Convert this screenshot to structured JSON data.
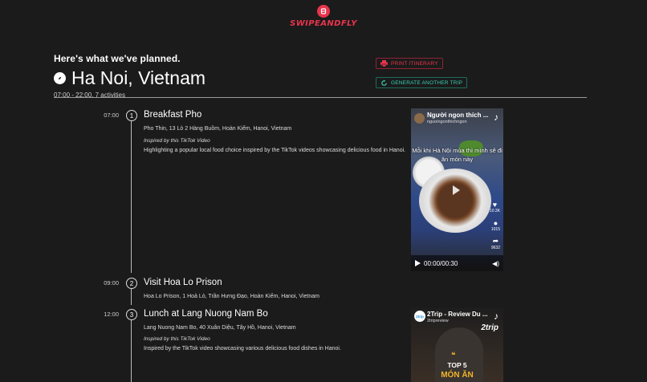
{
  "brand": {
    "name": "SWIPEANDFLY",
    "color": "#e8344c"
  },
  "header": {
    "planned_label": "Here's what we've planned.",
    "city": "Ha Noi, Vietnam",
    "meta": "07:00 - 22:00, 7 activities",
    "compass_icon": "compass-icon"
  },
  "buttons": {
    "print": {
      "label": "PRINT ITINERARY",
      "icon": "printer-icon",
      "color": "#e8344c"
    },
    "generate": {
      "label": "GENERATE ANOTHER TRIP",
      "icon": "refresh-icon",
      "color": "#38d0b0"
    }
  },
  "activities": [
    {
      "time": "07:00",
      "number": "1",
      "title": "Breakfast Pho",
      "address": "Pho Thin, 13 Lò 2 Hàng Buồm, Hoàn Kiếm, Hanoi, Vietnam",
      "inspired": "Inspired by this TikTok Video",
      "description": "Highlighting a popular local food choice inspired by the TikTok videos showcasing delicious food in Hanoi.",
      "video": {
        "title": "Người ngon thích ...",
        "user": "nguoingonthichngon",
        "caption": "Mỗi khi Hà Nội mùa thì mình sẽ đi ăn món này",
        "likes": "10.3K",
        "comments": "1015",
        "shares": "9632",
        "timecode": "00:00/00:30",
        "platform_icon": "tiktok-icon"
      }
    },
    {
      "time": "09:00",
      "number": "2",
      "title": "Visit Hoa Lo Prison",
      "address": "Hoa Lo Prison, 1 Hoả Lò, Trần Hưng Đạo, Hoàn Kiếm, Hanoi, Vietnam"
    },
    {
      "time": "12:00",
      "number": "3",
      "title": "Lunch at Lang Nuong Nam Bo",
      "address": "Lang Nuong Nam Bo, 40 Xuân Diệu, Tây Hồ, Hanoi, Vietnam",
      "inspired": "Inspired by this TikTok Video",
      "description": "Inspired by the TikTok video showcasing various delicious food dishes in Hanoi.",
      "video": {
        "title": "2Trip - Review Du ...",
        "user": "2tripreview",
        "avatar_text": "2trip",
        "brand": "2trip",
        "top_text": "TOP 5",
        "bottom_text": "MÓN ĂN",
        "platform_icon": "tiktok-icon"
      }
    }
  ]
}
